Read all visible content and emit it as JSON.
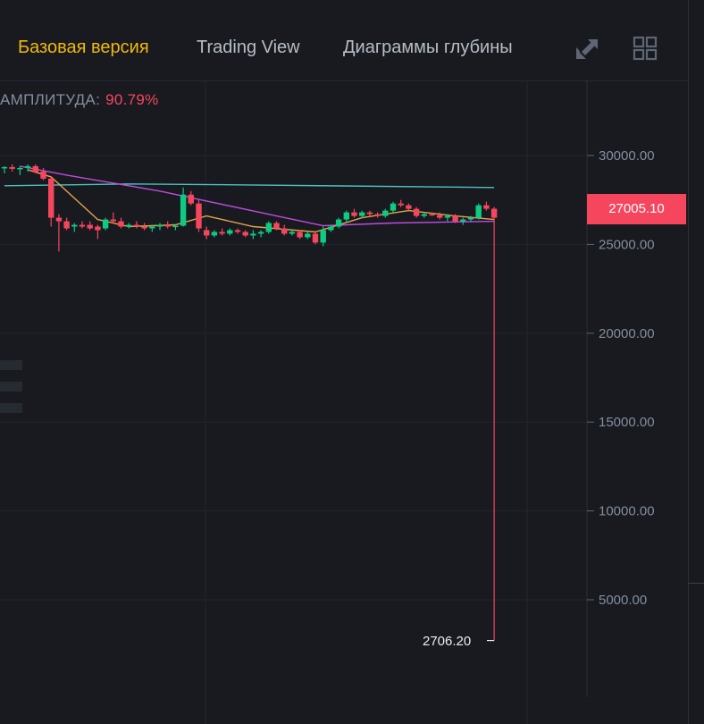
{
  "tabs": [
    {
      "label": "Базовая версия",
      "active": true
    },
    {
      "label": "Trading View",
      "active": false
    },
    {
      "label": "Диаграммы глубины",
      "active": false
    }
  ],
  "toolbar_icons": [
    "expand-icon",
    "grid-layout-icon"
  ],
  "amplitude": {
    "label": "АМПЛИТУДА:",
    "value": "90.79%"
  },
  "current_price": "27005.10",
  "low_label": "2706.20",
  "colors": {
    "background": "#181a20",
    "up": "#0ecb81",
    "down": "#f6465d",
    "accent": "#f0b90b",
    "ma_long": "#4fc1c0",
    "ma_mid": "#c04ae0",
    "ma_short": "#e3a34a"
  },
  "chart_data": {
    "type": "candlestick",
    "y_ticks": [
      "30000.00",
      "25000.00",
      "20000.00",
      "15000.00",
      "10000.00",
      "5000.00"
    ],
    "y_tick_values": [
      30000,
      25000,
      20000,
      15000,
      10000,
      5000
    ],
    "ylim": [
      -1500,
      34500
    ],
    "current_price": 27005.1,
    "low": 2706.2,
    "candles": [
      [
        29300,
        29400,
        29000,
        29350
      ],
      [
        29350,
        29500,
        29100,
        29250
      ],
      [
        29250,
        29400,
        28900,
        29300
      ],
      [
        29300,
        29500,
        29100,
        29400
      ],
      [
        29400,
        29500,
        29000,
        29050
      ],
      [
        29100,
        29300,
        28600,
        28700
      ],
      [
        28700,
        28800,
        26000,
        26500
      ],
      [
        26500,
        26700,
        24600,
        26300
      ],
      [
        26300,
        26500,
        25800,
        25900
      ],
      [
        26000,
        26200,
        25700,
        26100
      ],
      [
        26100,
        26300,
        25900,
        26000
      ],
      [
        26100,
        26300,
        25800,
        25900
      ],
      [
        26000,
        26100,
        25300,
        25800
      ],
      [
        25900,
        26500,
        25800,
        26400
      ],
      [
        26400,
        26800,
        26200,
        26300
      ],
      [
        26300,
        26500,
        25900,
        26000
      ],
      [
        26000,
        26200,
        25900,
        26100
      ],
      [
        26100,
        26300,
        25900,
        26000
      ],
      [
        26000,
        26200,
        25800,
        25900
      ],
      [
        25900,
        26100,
        25700,
        26000
      ],
      [
        26000,
        26200,
        25800,
        26100
      ],
      [
        26100,
        26300,
        25900,
        26000
      ],
      [
        26000,
        26100,
        25800,
        26050
      ],
      [
        26050,
        28200,
        26000,
        27800
      ],
      [
        27800,
        28000,
        27200,
        27300
      ],
      [
        27300,
        27500,
        25700,
        25900
      ],
      [
        25800,
        26000,
        25300,
        25500
      ],
      [
        25500,
        25800,
        25400,
        25700
      ],
      [
        25700,
        25900,
        25500,
        25600
      ],
      [
        25600,
        25900,
        25500,
        25800
      ],
      [
        25800,
        25900,
        25600,
        25700
      ],
      [
        25700,
        25800,
        25400,
        25500
      ],
      [
        25500,
        25800,
        25300,
        25600
      ],
      [
        25600,
        25800,
        25400,
        25700
      ],
      [
        25700,
        26300,
        25600,
        26200
      ],
      [
        26200,
        26300,
        25800,
        25900
      ],
      [
        25900,
        26100,
        25500,
        25600
      ],
      [
        25600,
        25800,
        25500,
        25700
      ],
      [
        25700,
        25800,
        25300,
        25400
      ],
      [
        25400,
        25700,
        25300,
        25600
      ],
      [
        25600,
        25700,
        25000,
        25100
      ],
      [
        25100,
        26000,
        24900,
        25800
      ],
      [
        25800,
        26100,
        25700,
        26000
      ],
      [
        26000,
        26500,
        25900,
        26400
      ],
      [
        26400,
        26900,
        26200,
        26800
      ],
      [
        26800,
        27000,
        26500,
        26600
      ],
      [
        26600,
        26900,
        26500,
        26800
      ],
      [
        26800,
        26900,
        26600,
        26700
      ],
      [
        26700,
        26800,
        26500,
        26600
      ],
      [
        26600,
        27000,
        26500,
        26900
      ],
      [
        26900,
        27400,
        26800,
        27300
      ],
      [
        27300,
        27500,
        27100,
        27200
      ],
      [
        27200,
        27300,
        26900,
        27000
      ],
      [
        27000,
        27100,
        26500,
        26600
      ],
      [
        26600,
        26800,
        26500,
        26700
      ],
      [
        26700,
        26800,
        26600,
        26650
      ],
      [
        26650,
        26800,
        26400,
        26500
      ],
      [
        26500,
        26700,
        26300,
        26600
      ],
      [
        26600,
        26700,
        26200,
        26300
      ],
      [
        26300,
        26500,
        26100,
        26400
      ],
      [
        26400,
        26600,
        26300,
        26500
      ],
      [
        26500,
        27300,
        26400,
        27200
      ],
      [
        27200,
        27400,
        26900,
        27005.1
      ],
      [
        27005.1,
        27100,
        2706.2,
        26500
      ]
    ],
    "ma_long": [
      [
        0,
        28300
      ],
      [
        16,
        28400
      ],
      [
        30,
        28350
      ],
      [
        63,
        28200
      ]
    ],
    "ma_mid": [
      [
        2,
        29400
      ],
      [
        8,
        28900
      ],
      [
        20,
        28000
      ],
      [
        35,
        26600
      ],
      [
        41,
        26050
      ],
      [
        50,
        26200
      ],
      [
        63,
        26300
      ]
    ],
    "ma_short": [
      [
        3,
        29200
      ],
      [
        6,
        28800
      ],
      [
        12,
        26400
      ],
      [
        16,
        26000
      ],
      [
        22,
        26100
      ],
      [
        26,
        26600
      ],
      [
        32,
        26000
      ],
      [
        40,
        25700
      ],
      [
        46,
        26500
      ],
      [
        52,
        26900
      ],
      [
        58,
        26600
      ],
      [
        63,
        26400
      ]
    ]
  }
}
